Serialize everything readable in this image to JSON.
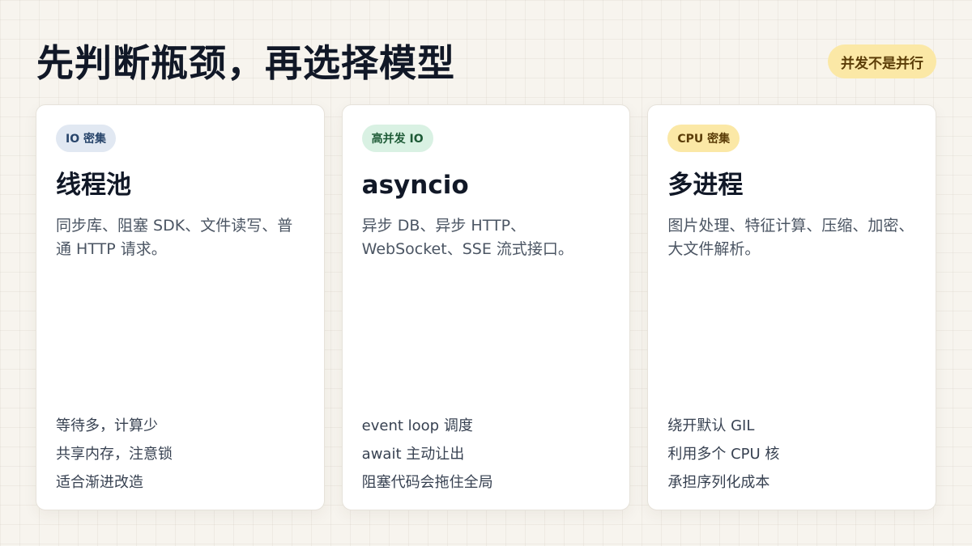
{
  "title": "先判断瓶颈，再选择模型",
  "badge": "并发不是并行",
  "colors": {
    "background": "#f7f4ee",
    "badge_bg": "#fbe8a6",
    "badge_text": "#5b3d08"
  },
  "cards": [
    {
      "tag": "IO 密集",
      "tag_bg": "#e1e8f2",
      "tag_color": "#28456b",
      "title": "线程池",
      "desc": "同步库、阻塞 SDK、文件读写、普通 HTTP 请求。",
      "points": [
        "等待多，计算少",
        "共享内存，注意锁",
        "适合渐进改造"
      ]
    },
    {
      "tag": "高并发 IO",
      "tag_bg": "#d9f1e3",
      "tag_color": "#1d5a36",
      "title": "asyncio",
      "desc": "异步 DB、异步 HTTP、WebSocket、SSE 流式接口。",
      "points": [
        "event loop 调度",
        "await 主动让出",
        "阻塞代码会拖住全局"
      ]
    },
    {
      "tag": "CPU 密集",
      "tag_bg": "#fbe8a6",
      "tag_color": "#5b3d08",
      "title": "多进程",
      "desc": "图片处理、特征计算、压缩、加密、大文件解析。",
      "points": [
        "绕开默认 GIL",
        "利用多个 CPU 核",
        "承担序列化成本"
      ]
    }
  ]
}
